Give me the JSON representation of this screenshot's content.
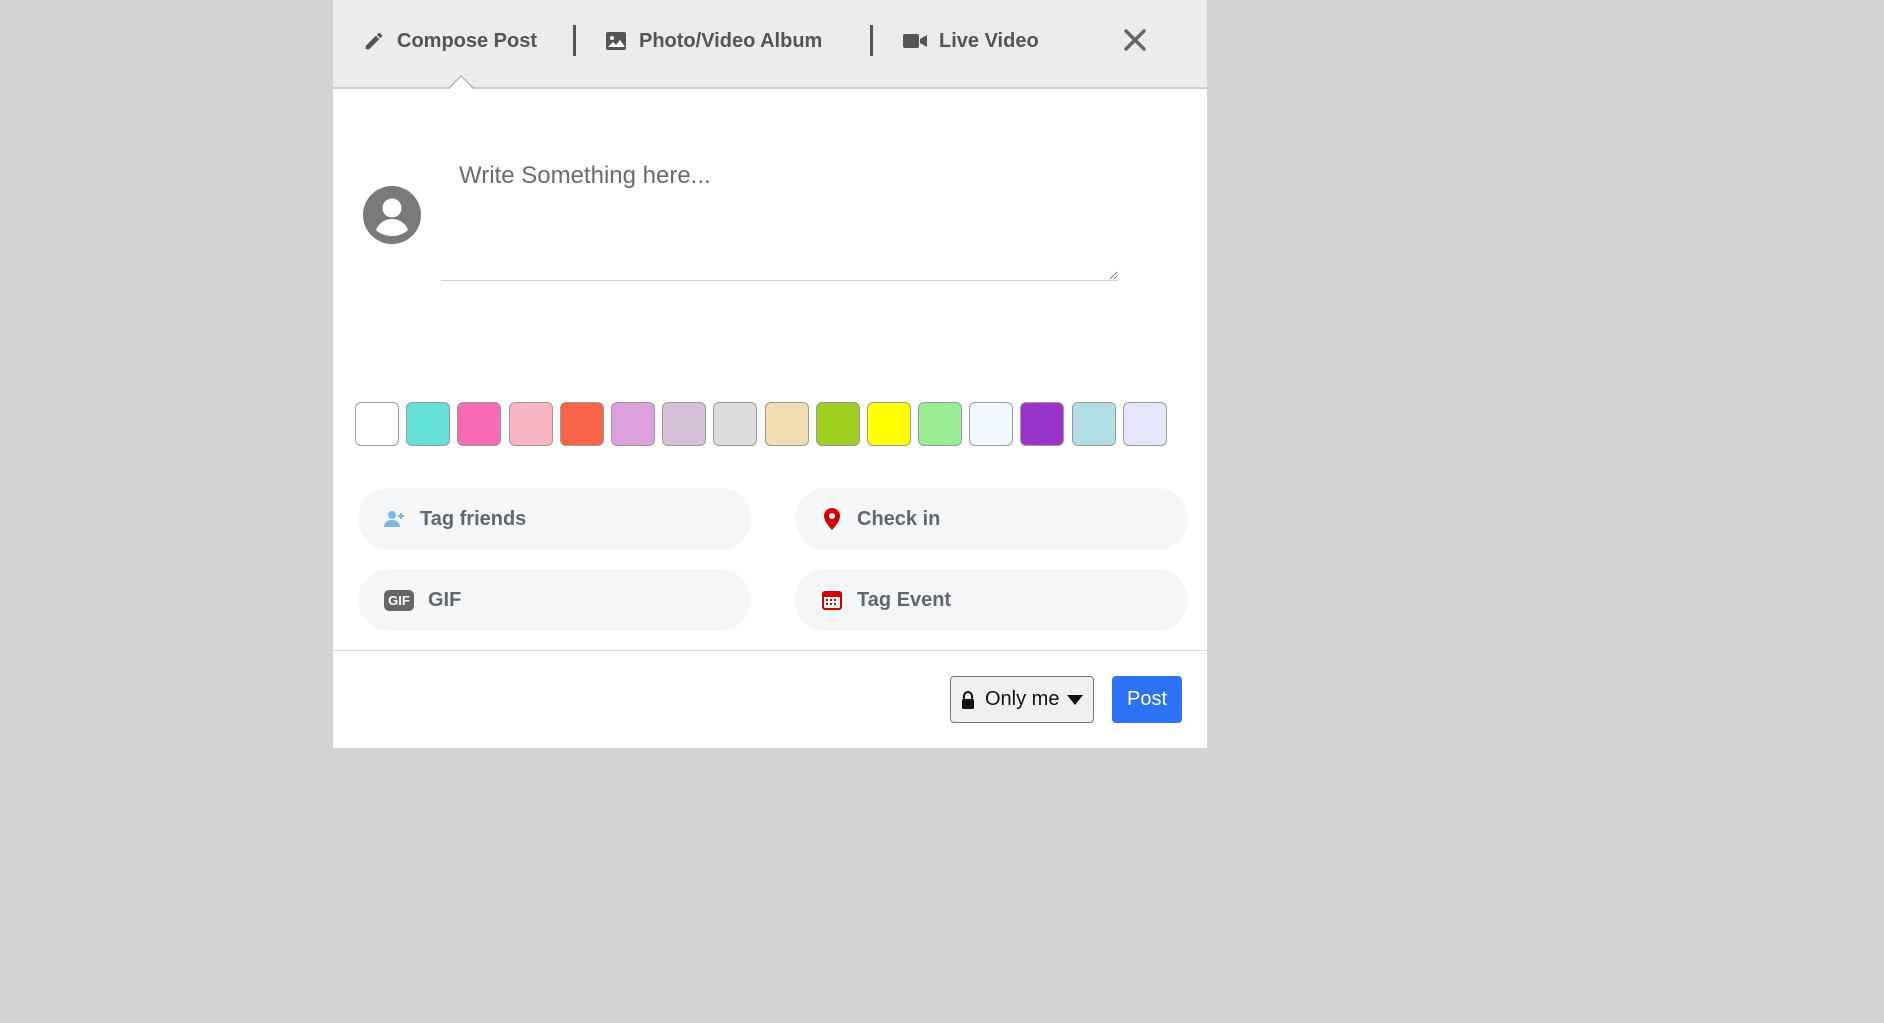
{
  "tabs": [
    {
      "label": "Compose Post",
      "icon": "pencil-icon"
    },
    {
      "label": "Photo/Video Album",
      "icon": "image-icon"
    },
    {
      "label": "Live Video",
      "icon": "video-camera-icon"
    }
  ],
  "composer": {
    "placeholder": "Write Something here..."
  },
  "swatches": [
    "#ffffff",
    "#63e0d4",
    "#f76bb6",
    "#f9b5c1",
    "#f66445",
    "#dda0dd",
    "#d6bfd8",
    "#dcdcdc",
    "#f3deb3",
    "#9fd01f",
    "#ffff00",
    "#99ee91",
    "#f0f8ff",
    "#9932cc",
    "#b0e0e6",
    "#e6e6fa"
  ],
  "options": {
    "tag_friends": "Tag friends",
    "check_in": "Check in",
    "gif": "GIF",
    "gif_badge": "GIF",
    "tag_event": "Tag Event"
  },
  "footer": {
    "privacy": "Only me",
    "post": "Post"
  },
  "colors": {
    "accent": "#2d72f6",
    "pin": "#d40000",
    "calendar": "#d40000",
    "tag_icon": "#7db7e6"
  }
}
